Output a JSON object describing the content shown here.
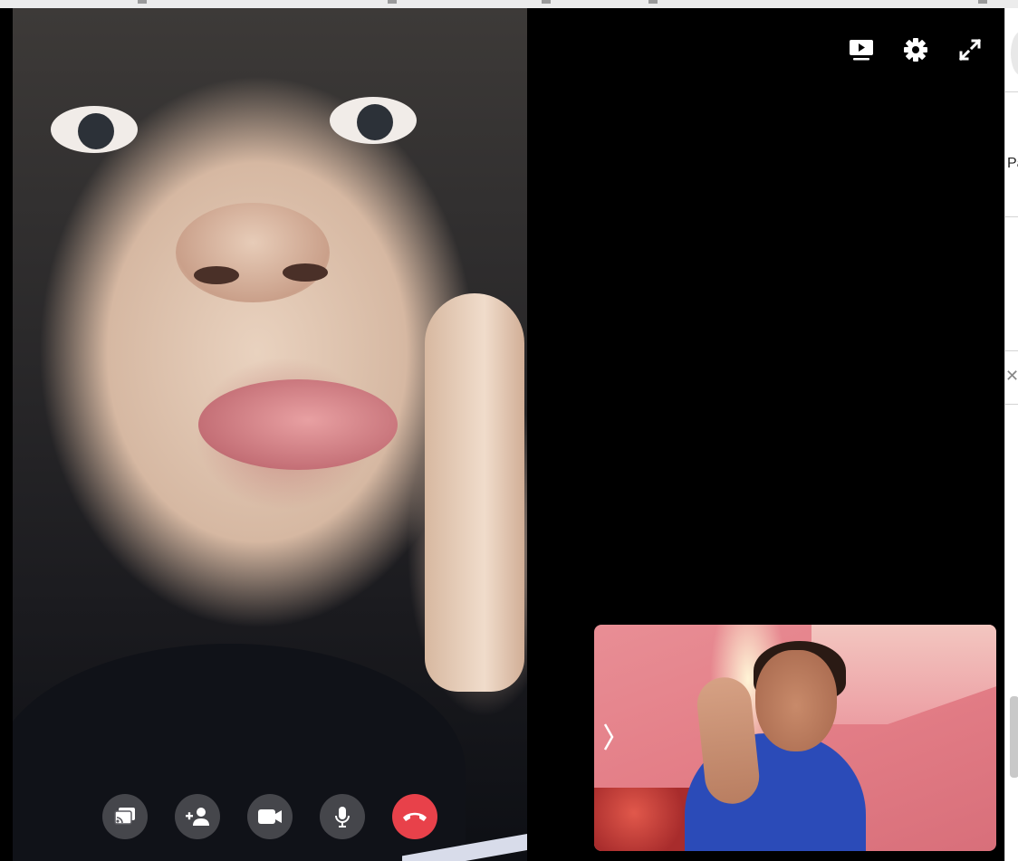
{
  "icons": {
    "present": "present-screen-icon",
    "settings": "gear-icon",
    "fullscreen": "fullscreen-icon",
    "cast": "cast-icon",
    "add_person": "add-person-icon",
    "video": "video-camera-icon",
    "mic": "microphone-icon",
    "end_call": "end-call-icon",
    "expand": "chevron-right-icon",
    "close": "close-icon"
  },
  "colors": {
    "end_call": "#e8414a",
    "control_bg": "#5a5a60",
    "stage_bg": "#000000"
  },
  "side_panel": {
    "text_fragment": "Pa",
    "close_glyph": "✕"
  }
}
